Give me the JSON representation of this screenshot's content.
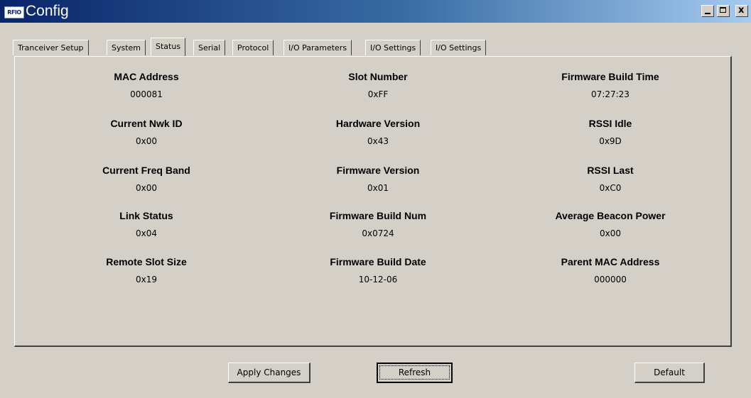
{
  "window": {
    "title": "Config",
    "icon_text": "RFIO",
    "controls": {
      "minimize": "minimize",
      "maximize": "maximize",
      "close_glyph": "x"
    }
  },
  "tabs": [
    {
      "label": "Tranceiver Setup",
      "active": false
    },
    {
      "label": "System",
      "active": false
    },
    {
      "label": "Status",
      "active": true
    },
    {
      "label": "Serial",
      "active": false
    },
    {
      "label": "Protocol",
      "active": false
    },
    {
      "label": "I/O Parameters",
      "active": false
    },
    {
      "label": "I/O Settings",
      "active": false
    },
    {
      "label": "I/O Settings",
      "active": false
    }
  ],
  "status": {
    "columns": [
      [
        {
          "label": "MAC Address",
          "value": "000081"
        },
        {
          "label": "Current Nwk ID",
          "value": "0x00"
        },
        {
          "label": "Current Freq Band",
          "value": "0x00"
        },
        {
          "label": "Link Status",
          "value": "0x04"
        },
        {
          "label": "Remote Slot Size",
          "value": "0x19"
        }
      ],
      [
        {
          "label": "Slot Number",
          "value": "0xFF"
        },
        {
          "label": "Hardware Version",
          "value": "0x43"
        },
        {
          "label": "Firmware Version",
          "value": "0x01"
        },
        {
          "label": "Firmware Build Num",
          "value": "0x0724"
        },
        {
          "label": "Firmware Build Date",
          "value": "10-12-06"
        }
      ],
      [
        {
          "label": "Firmware Build Time",
          "value": "07:27:23"
        },
        {
          "label": "RSSI Idle",
          "value": "0x9D"
        },
        {
          "label": "RSSI Last",
          "value": "0xC0"
        },
        {
          "label": "Average Beacon Power",
          "value": "0x00"
        },
        {
          "label": "Parent MAC Address",
          "value": "000000"
        }
      ]
    ]
  },
  "buttons": {
    "apply": "Apply Changes",
    "refresh": "Refresh",
    "default": "Default"
  }
}
